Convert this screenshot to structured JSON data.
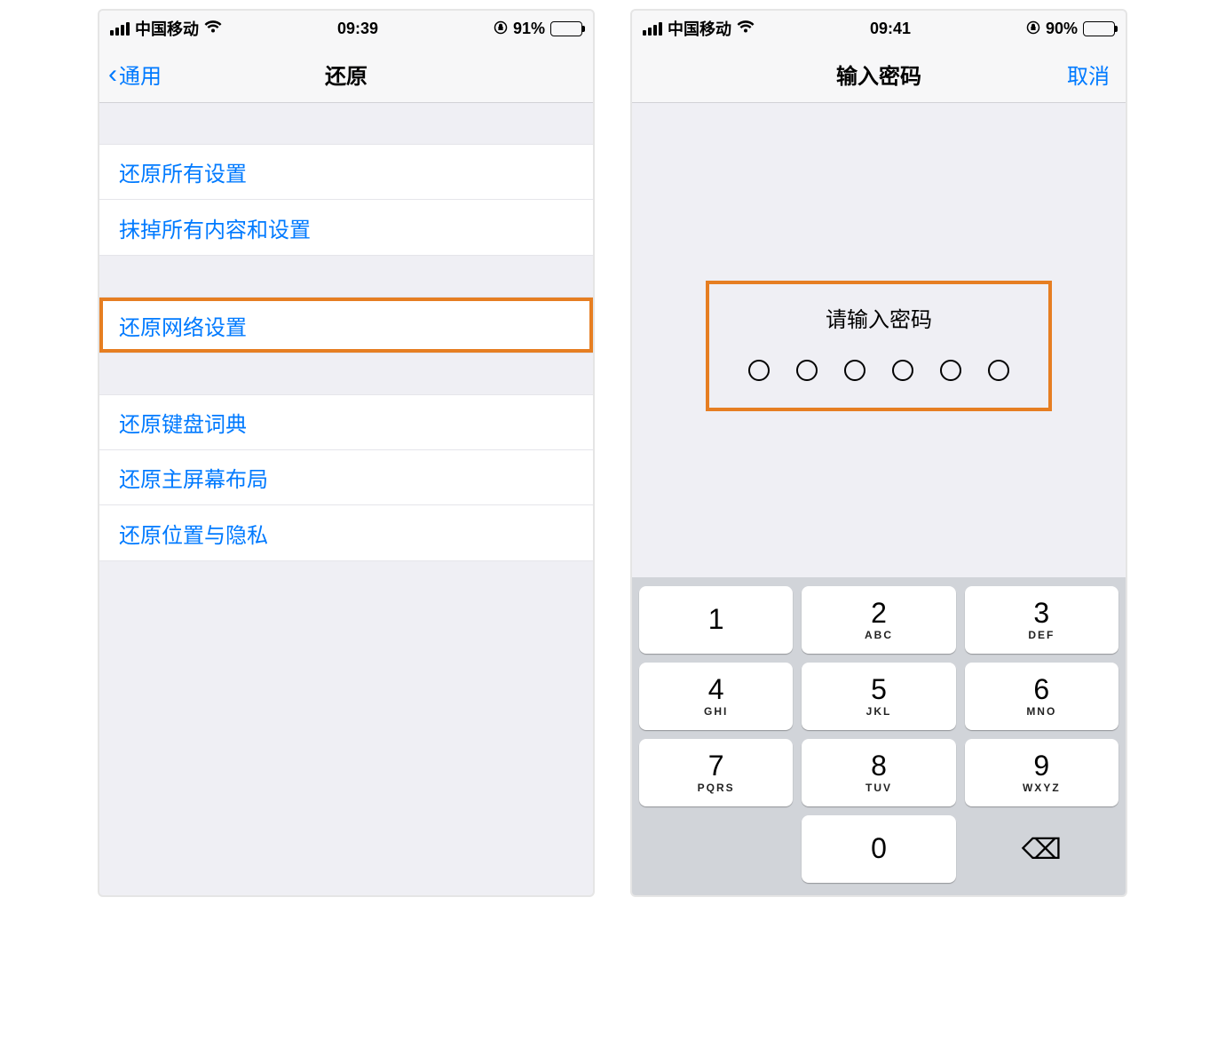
{
  "left": {
    "status": {
      "carrier": "中国移动",
      "time": "09:39",
      "battery_pct": "91%"
    },
    "nav": {
      "back": "通用",
      "title": "还原"
    },
    "group1": [
      {
        "name": "reset-all-settings",
        "label": "还原所有设置"
      },
      {
        "name": "erase-all-content",
        "label": "抹掉所有内容和设置"
      }
    ],
    "group2": [
      {
        "name": "reset-network-settings",
        "label": "还原网络设置",
        "highlight": true
      }
    ],
    "group3": [
      {
        "name": "reset-keyboard-dict",
        "label": "还原键盘词典"
      },
      {
        "name": "reset-home-layout",
        "label": "还原主屏幕布局"
      },
      {
        "name": "reset-location-privacy",
        "label": "还原位置与隐私"
      }
    ]
  },
  "right": {
    "status": {
      "carrier": "中国移动",
      "time": "09:41",
      "battery_pct": "90%"
    },
    "nav": {
      "title": "输入密码",
      "cancel": "取消"
    },
    "prompt": "请输入密码",
    "digits": 6,
    "keypad": [
      {
        "n": "1",
        "l": ""
      },
      {
        "n": "2",
        "l": "ABC"
      },
      {
        "n": "3",
        "l": "DEF"
      },
      {
        "n": "4",
        "l": "GHI"
      },
      {
        "n": "5",
        "l": "JKL"
      },
      {
        "n": "6",
        "l": "MNO"
      },
      {
        "n": "7",
        "l": "PQRS"
      },
      {
        "n": "8",
        "l": "TUV"
      },
      {
        "n": "9",
        "l": "WXYZ"
      },
      {
        "n": "",
        "l": "",
        "blank": true
      },
      {
        "n": "0",
        "l": ""
      },
      {
        "n": "",
        "l": "",
        "del": true
      }
    ]
  }
}
